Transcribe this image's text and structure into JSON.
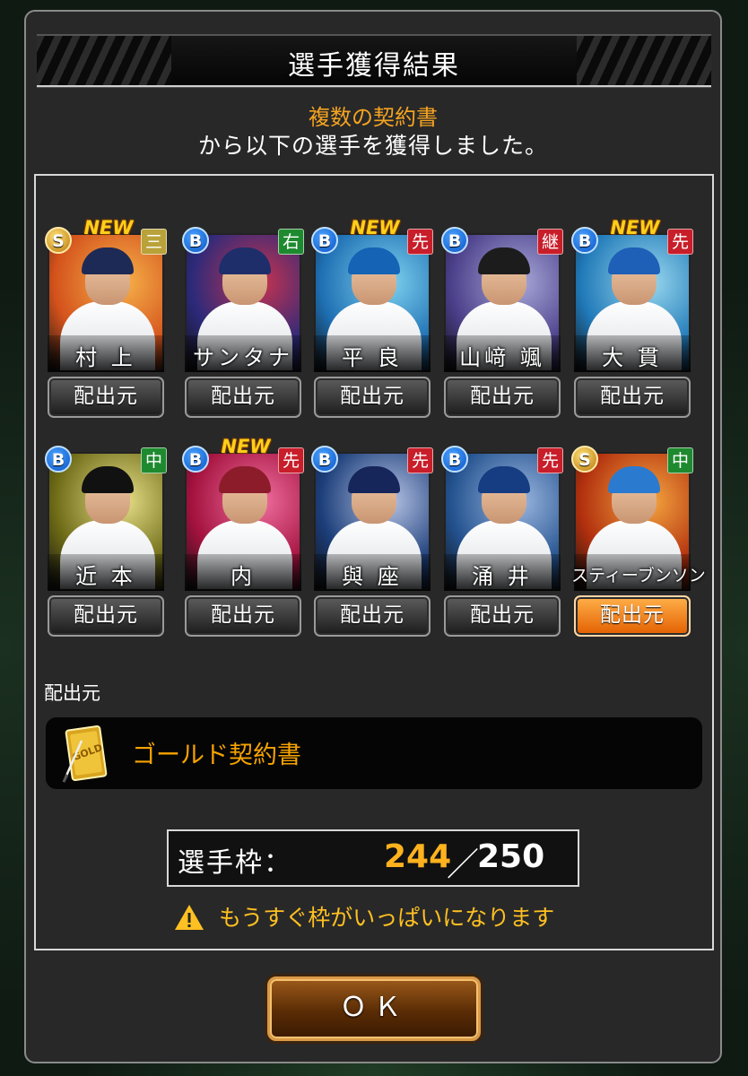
{
  "title": "選手獲得結果",
  "description": {
    "source_highlight": "複数の契約書",
    "message": "から以下の選手を獲得しました。"
  },
  "players": [
    {
      "name": "村 上",
      "rank": "S",
      "position": "三",
      "position_color": "#b9a23a",
      "is_new": true,
      "new_label": "NEW",
      "source_button": "配出元",
      "selected": false,
      "bg": "#d4521c",
      "bg2": "#f6b24a",
      "cap": "#1d2a55"
    },
    {
      "name": "サンタナ",
      "rank": "B",
      "position": "右",
      "position_color": "#1e8a2f",
      "is_new": false,
      "new_label": "",
      "source_button": "配出元",
      "selected": false,
      "bg": "#2c2a7a",
      "bg2": "#c8334f",
      "cap": "#1e2e6a"
    },
    {
      "name": "平 良",
      "rank": "B",
      "position": "先",
      "position_color": "#c81e2a",
      "is_new": true,
      "new_label": "NEW",
      "source_button": "配出元",
      "selected": false,
      "bg": "#1e6fb3",
      "bg2": "#7ed2ef",
      "cap": "#1463b5"
    },
    {
      "name": "山﨑 颯",
      "rank": "B",
      "position": "継",
      "position_color": "#c81e2a",
      "is_new": false,
      "new_label": "",
      "source_button": "配出元",
      "selected": false,
      "bg": "#4b3f8a",
      "bg2": "#a8a9d9",
      "cap": "#1c1c1c"
    },
    {
      "name": "大 貫",
      "rank": "B",
      "position": "先",
      "position_color": "#c81e2a",
      "is_new": true,
      "new_label": "NEW",
      "source_button": "配出元",
      "selected": false,
      "bg": "#2079b8",
      "bg2": "#9ad9ef",
      "cap": "#1e5fb7"
    },
    {
      "name": "近 本",
      "rank": "B",
      "position": "中",
      "position_color": "#1e8a2f",
      "is_new": false,
      "new_label": "",
      "source_button": "配出元",
      "selected": false,
      "bg": "#6d6a16",
      "bg2": "#e9e08a",
      "cap": "#111111"
    },
    {
      "name": "内",
      "rank": "B",
      "position": "先",
      "position_color": "#c81e2a",
      "is_new": true,
      "new_label": "NEW",
      "source_button": "配出元",
      "selected": false,
      "bg": "#a4123e",
      "bg2": "#f06fa0",
      "cap": "#8c1c2a"
    },
    {
      "name": "與 座",
      "rank": "B",
      "position": "先",
      "position_color": "#c81e2a",
      "is_new": false,
      "new_label": "",
      "source_button": "配出元",
      "selected": false,
      "bg": "#1c3e7a",
      "bg2": "#b7c4e5",
      "cap": "#16265a"
    },
    {
      "name": "涌 井",
      "rank": "B",
      "position": "先",
      "position_color": "#c81e2a",
      "is_new": false,
      "new_label": "",
      "source_button": "配出元",
      "selected": false,
      "bg": "#23528f",
      "bg2": "#9cb7e0",
      "cap": "#163d82"
    },
    {
      "name": "スティーブンソン",
      "rank": "S",
      "position": "中",
      "position_color": "#1e8a2f",
      "is_new": false,
      "new_label": "",
      "source_button": "配出元",
      "selected": true,
      "bg": "#b2300e",
      "bg2": "#f5a640",
      "cap": "#2a7ad0"
    }
  ],
  "source_section": {
    "label": "配出元",
    "item_name": "ゴールド契約書",
    "icon": "gold-contract-icon"
  },
  "slots": {
    "label": "選手枠：",
    "current": "244",
    "separator": "／",
    "max": "250"
  },
  "warning": {
    "icon": "warning-icon",
    "text": "もうすぐ枠がいっぱいになります"
  },
  "ok_button": "ＯＫ"
}
